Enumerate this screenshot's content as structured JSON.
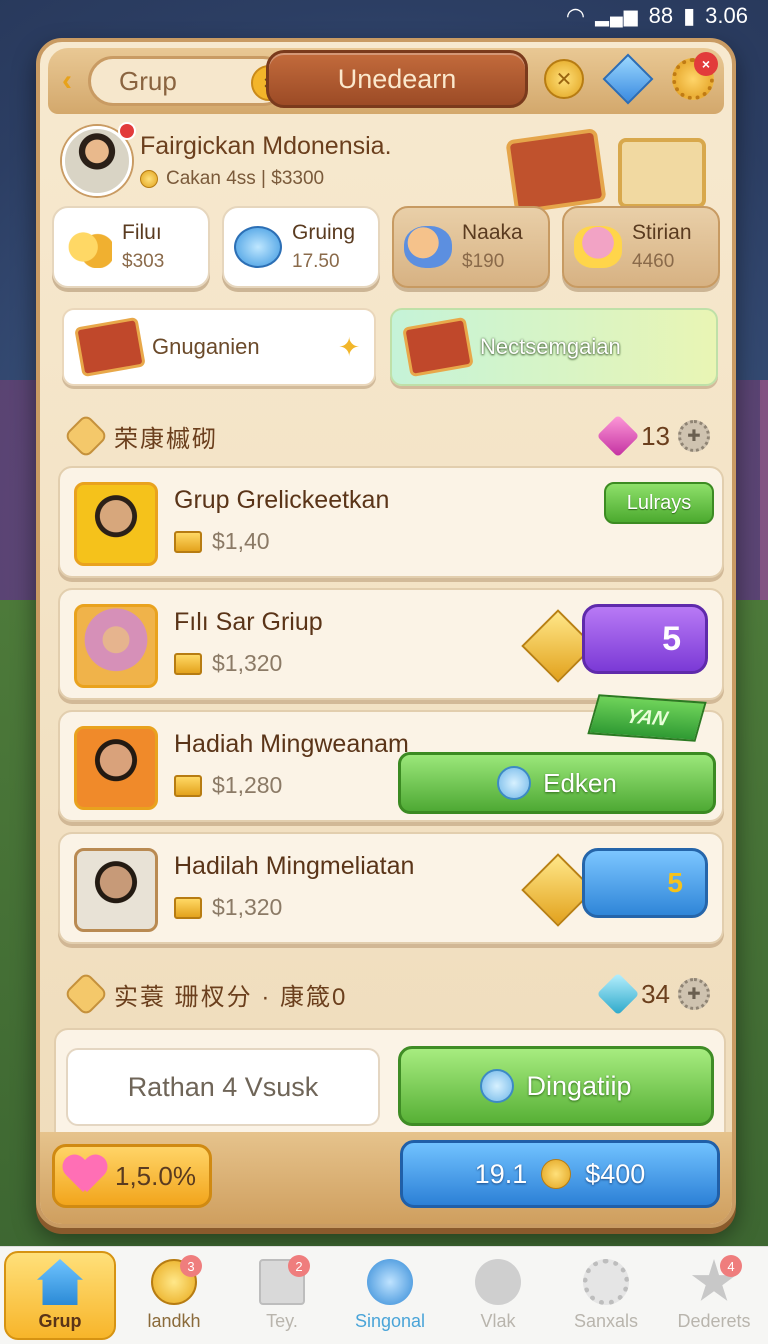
{
  "status_bar": {
    "signal": "88",
    "time": "3.06"
  },
  "topbar": {
    "group_label": "Grup",
    "close_glyph": "×",
    "title": "Unedearn",
    "icons": [
      "coins-icon",
      "gem-icon",
      "gear-icon"
    ],
    "gear_badge": "×"
  },
  "profile": {
    "name": "Fairgickan Mdonensia.",
    "subtitle": "Cakan 4ss | $3300"
  },
  "stats": [
    {
      "title": "Filuı",
      "value": "$303",
      "icon": "coins-icon"
    },
    {
      "title": "Gruing",
      "value": "17.50",
      "icon": "blue-orb-icon"
    },
    {
      "title": "Naaka",
      "value": "$190",
      "icon": "toy-icon"
    },
    {
      "title": "Stirian",
      "value": "4460",
      "icon": "cat-icon"
    }
  ],
  "banners": [
    {
      "label": "Gnuganien"
    },
    {
      "label": "Nectsemgaian"
    }
  ],
  "section1": {
    "title": "荣康槭砌",
    "count": "13"
  },
  "rows": [
    {
      "name": "Grup Grelickeetkan",
      "amount": "$1,40",
      "button": "Lulrays"
    },
    {
      "name": "Fılı Sar Griup",
      "amount": "$1,320",
      "badge": "5"
    },
    {
      "name": "Hadiah Mingweanam",
      "amount": "$1,280",
      "ribbon": "YAN",
      "button": "Edken"
    },
    {
      "name": "Hadilah Mingmeliatan",
      "amount": "$1,320",
      "badge": "5"
    }
  ],
  "section2": {
    "title": "实蓑  珊杈分 · 康箴0",
    "count": "34"
  },
  "action": {
    "input_text": "Rathan 4 Vsusk",
    "button": "Dingatiip"
  },
  "footer": {
    "percent": "1,5.0%",
    "left_value": "19.1",
    "money": "$400"
  },
  "nav": [
    {
      "label": "Grup",
      "icon": "home-icon",
      "active": true
    },
    {
      "label": "landkh",
      "icon": "coin-icon",
      "badge": "3"
    },
    {
      "label": "Tey.",
      "icon": "box-icon",
      "badge": "2"
    },
    {
      "label": "Singonal",
      "icon": "star-icon"
    },
    {
      "label": "Vlak",
      "icon": "cloud-icon"
    },
    {
      "label": "Sanxals",
      "icon": "gear-icon"
    },
    {
      "label": "Dederets",
      "icon": "star-outline-icon",
      "badge": "4"
    }
  ],
  "colors": {
    "panel": "#f7e9cf",
    "accent_green": "#4caa2f",
    "accent_blue": "#2c80d6",
    "accent_gold": "#f2a51c"
  }
}
